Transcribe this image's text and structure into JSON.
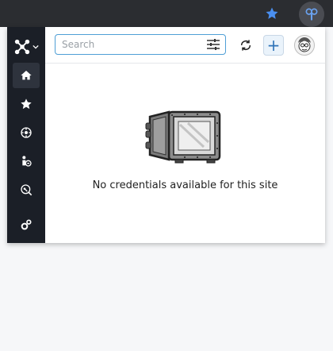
{
  "browser": {
    "bookmark_icon": "star-icon",
    "extension_icon": "passbolt-icon",
    "accent": "#4a8ff0"
  },
  "sidebar": {
    "logo_icon": "passbolt-logo-icon",
    "items": [
      {
        "icon": "home-icon",
        "active": true
      },
      {
        "icon": "star-icon",
        "active": false
      },
      {
        "icon": "folder-share-icon",
        "active": false
      },
      {
        "icon": "user-group-icon",
        "active": false
      },
      {
        "icon": "key-search-icon",
        "active": false
      },
      {
        "icon": "settings-gears-icon",
        "active": false
      }
    ]
  },
  "header": {
    "search_placeholder": "Search",
    "search_value": "",
    "filter_icon": "sliders-icon",
    "sync_icon": "sync-icon",
    "add_label": "+",
    "avatar_icon": "user-avatar"
  },
  "empty_state": {
    "illustration": "open-safe",
    "message": "No credentials available for this site"
  },
  "colors": {
    "sidebar_bg": "#1b1f27",
    "search_border": "#4f9fd6",
    "add_button": "#2f73b8"
  }
}
